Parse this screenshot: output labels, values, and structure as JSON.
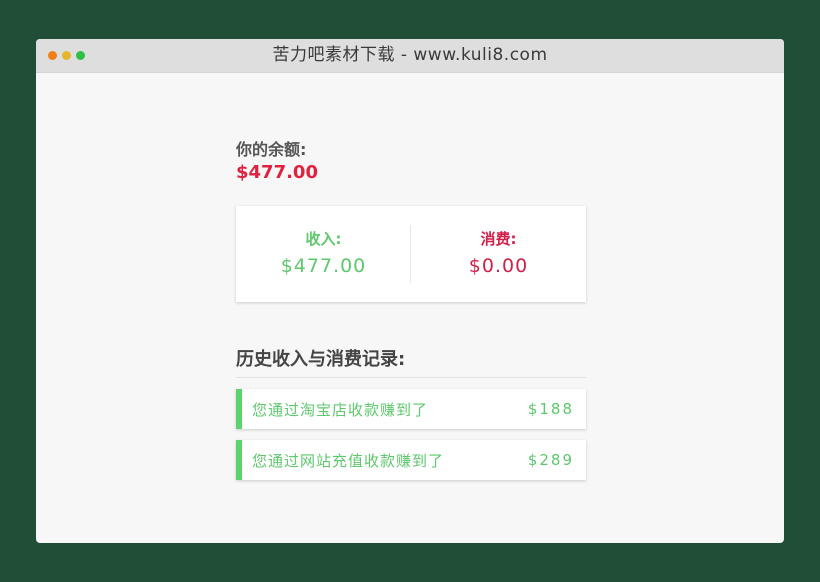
{
  "window": {
    "title": "苦力吧素材下载 - www.kuli8.com",
    "dots": [
      "#f07f14",
      "#e5b52b",
      "#2fbf44"
    ]
  },
  "balance": {
    "label": "你的余额:",
    "amount": "$477.00"
  },
  "summary": {
    "income_label": "收入:",
    "income_value": "$477.00",
    "expense_label": "消费:",
    "expense_value": "$0.00"
  },
  "history": {
    "title": "历史收入与消费记录:",
    "items": [
      {
        "text": "您通过淘宝店收款赚到了",
        "amount": "$188"
      },
      {
        "text": "您通过网站充值收款赚到了",
        "amount": "$289"
      }
    ]
  },
  "colors": {
    "income": "#5dc86c",
    "expense": "#d1224a",
    "balance": "#e0213f",
    "accent_bar": "#5cd36e"
  }
}
